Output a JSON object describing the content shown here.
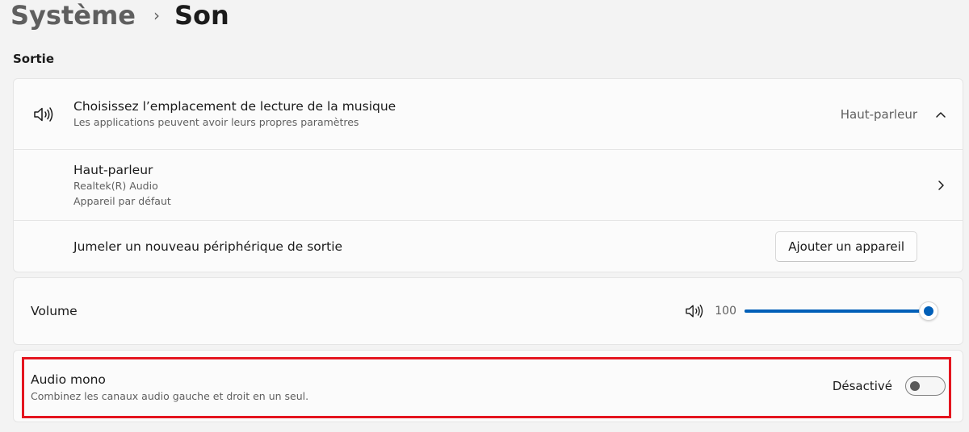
{
  "breadcrumb": {
    "parent": "Système",
    "separator": "›",
    "current": "Son"
  },
  "output_section": {
    "title": "Sortie",
    "location_row": {
      "icon": "speaker-icon",
      "title": "Choisissez l’emplacement de lecture de la musique",
      "subtitle": "Les applications peuvent avoir leurs propres paramètres",
      "value": "Haut-parleur",
      "expanded": true
    },
    "speaker_row": {
      "title": "Haut-parleur",
      "line1": "Realtek(R) Audio",
      "line2": "Appareil par défaut"
    },
    "pair_row": {
      "title": "Jumeler un nouveau périphérique de sortie",
      "button_label": "Ajouter un appareil"
    }
  },
  "volume": {
    "label": "Volume",
    "icon": "speaker-icon",
    "value": "100",
    "level": 1.0
  },
  "mono_audio": {
    "title": "Audio mono",
    "subtitle": "Combinez les canaux audio gauche et droit en un seul.",
    "state_label": "Désactivé",
    "enabled": false
  },
  "colors": {
    "accent": "#005fb8",
    "highlight": "#e4151f"
  }
}
